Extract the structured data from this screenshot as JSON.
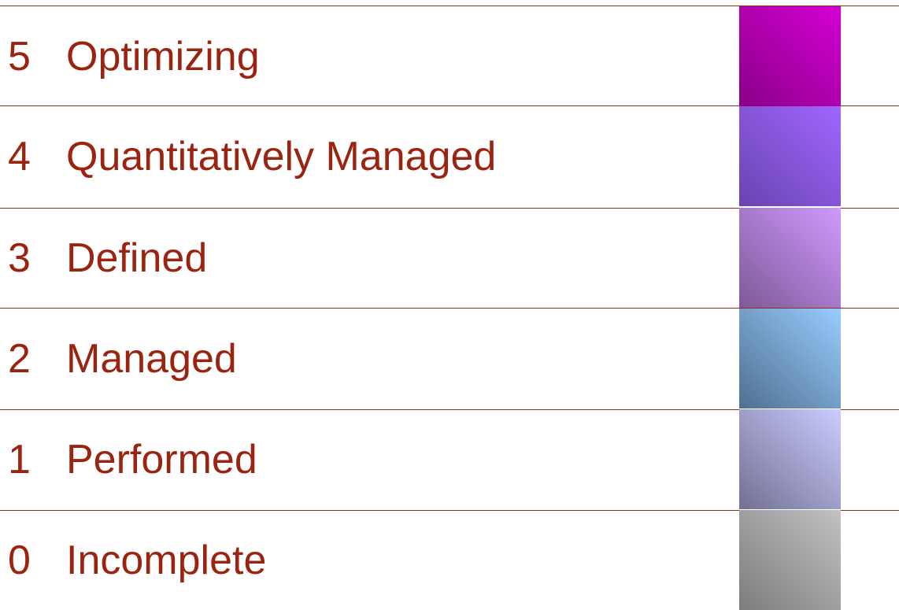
{
  "levels": [
    {
      "number": "5",
      "name": "Optimizing",
      "color_light": "#d400d4",
      "color_dark": "#8a0086"
    },
    {
      "number": "4",
      "name": "Quantitatively Managed",
      "color_light": "#a066ff",
      "color_dark": "#6a44b0"
    },
    {
      "number": "3",
      "name": "Defined",
      "color_light": "#d199ff",
      "color_dark": "#7c5a96"
    },
    {
      "number": "2",
      "name": "Managed",
      "color_light": "#99ccff",
      "color_dark": "#4f7090"
    },
    {
      "number": "1",
      "name": "Performed",
      "color_light": "#ccccff",
      "color_dark": "#717092"
    },
    {
      "number": "0",
      "name": "Incomplete",
      "color_light": "#c2c2c2",
      "color_dark": "#7c7c7c"
    }
  ],
  "colors": {
    "text": "#9b2410",
    "rule": "#9b2a18",
    "background": "#ffffff"
  }
}
